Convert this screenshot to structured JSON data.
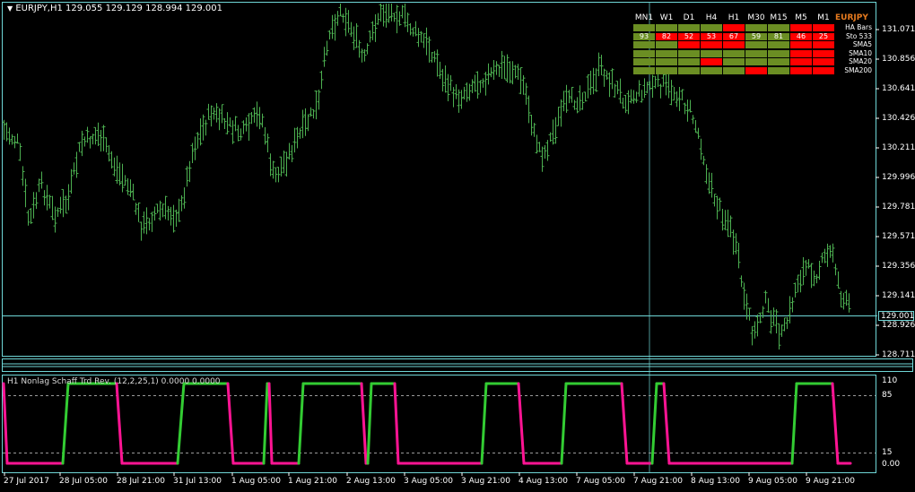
{
  "chart": {
    "title": "EURJPY,H1  129.055 129.129 128.994 129.001",
    "current_price": "129.001",
    "y_labels": [
      "131.071",
      "130.856",
      "130.641",
      "130.426",
      "130.211",
      "129.996",
      "129.781",
      "129.571",
      "129.356",
      "129.141",
      "128.926",
      "128.711"
    ],
    "x_labels": [
      "27 Jul 2017",
      "28 Jul 05:00",
      "28 Jul 21:00",
      "31 Jul 13:00",
      "1 Aug 05:00",
      "1 Aug 21:00",
      "2 Aug 13:00",
      "3 Aug 05:00",
      "3 Aug 21:00",
      "4 Aug 13:00",
      "7 Aug 05:00",
      "7 Aug 21:00",
      "8 Aug 13:00",
      "9 Aug 05:00",
      "9 Aug 21:00"
    ],
    "bar_color": "#4caf50",
    "grid_line_color": "#6fd6d6"
  },
  "indicator": {
    "title": "H1 Nonlag Schaff Trd Rev. (12,2,25,1) 0.0000 0.0000",
    "y_labels": [
      "110",
      "85",
      "15",
      "0.00"
    ],
    "up_color": "#33cc33",
    "down_color": "#ff1493"
  },
  "dashboard": {
    "pair": "EURJPY",
    "timeframes": [
      "MN1",
      "W1",
      "D1",
      "H4",
      "H1",
      "M30",
      "M15",
      "M5",
      "M1"
    ],
    "rows": [
      {
        "label": "HA Bars",
        "cells": [
          "g",
          "g",
          "g",
          "g",
          "r",
          "g",
          "g",
          "r",
          "r"
        ],
        "values": [
          "",
          "",
          "",
          "",
          "",
          "",
          "",
          "",
          ""
        ]
      },
      {
        "label": "Sto 533",
        "cells": [
          "g",
          "r",
          "r",
          "r",
          "r",
          "g",
          "g",
          "r",
          "r"
        ],
        "values": [
          "93",
          "82",
          "52",
          "53",
          "67",
          "59",
          "81",
          "46",
          "25"
        ]
      },
      {
        "label": "SMA5",
        "cells": [
          "g",
          "g",
          "r",
          "r",
          "r",
          "g",
          "g",
          "r",
          "r"
        ],
        "values": [
          "",
          "",
          "",
          "",
          "",
          "",
          "",
          "",
          ""
        ]
      },
      {
        "label": "SMA10",
        "cells": [
          "g",
          "g",
          "g",
          "g",
          "g",
          "g",
          "g",
          "r",
          "r"
        ],
        "values": [
          "",
          "",
          "",
          "",
          "",
          "",
          "",
          "",
          ""
        ]
      },
      {
        "label": "SMA20",
        "cells": [
          "g",
          "g",
          "g",
          "r",
          "g",
          "g",
          "g",
          "r",
          "r"
        ],
        "values": [
          "",
          "",
          "",
          "",
          "",
          "",
          "",
          "",
          ""
        ]
      },
      {
        "label": "SMA200",
        "cells": [
          "g",
          "g",
          "g",
          "g",
          "g",
          "r",
          "g",
          "r",
          "r"
        ],
        "values": [
          "",
          "",
          "",
          "",
          "",
          "",
          "",
          "",
          ""
        ]
      }
    ],
    "green": "#6b8e23",
    "red": "#ff0000"
  }
}
